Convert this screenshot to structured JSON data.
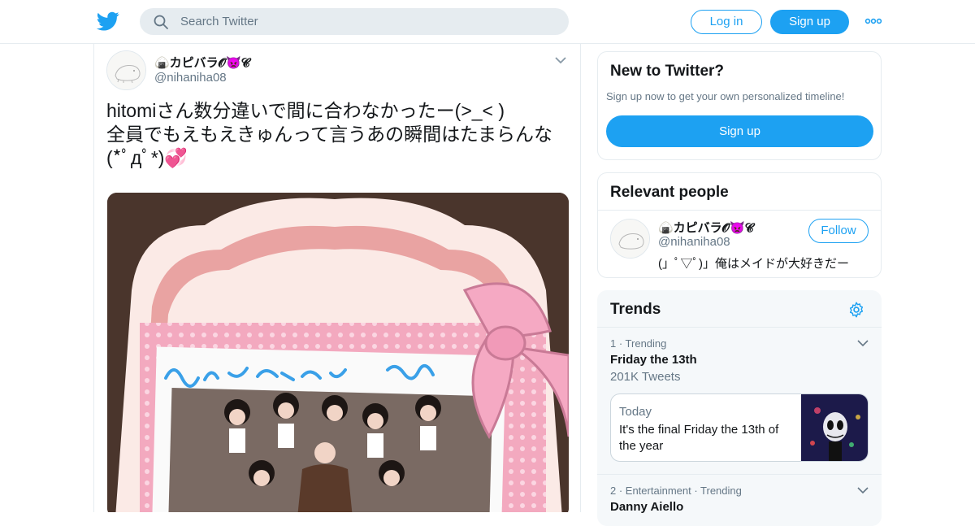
{
  "colors": {
    "brand": "#1da1f2",
    "muted": "#657786",
    "border": "#e6ecf0",
    "trends_bg": "#f5f8fa"
  },
  "topbar": {
    "logo": "twitter-bird-icon",
    "search_placeholder": "Search Twitter",
    "login_label": "Log in",
    "signup_label": "Sign up",
    "more_icon": "more-dots-icon"
  },
  "tweet": {
    "display_name": "🍙カピバラ𝓞👿𝓒",
    "handle": "@nihaniha08",
    "text": "hitomiさん数分違いで間に合わなかったー(>_< )\n全員でもえもえきゅんって言うあの瞬間はたまらんな(*ﾟдﾟ*)💞",
    "photo_icon": "tweet-photo"
  },
  "new_to_twitter": {
    "title": "New to Twitter?",
    "subtitle": "Sign up now to get your own personalized timeline!",
    "button_label": "Sign up"
  },
  "relevant_people": {
    "title": "Relevant people",
    "person": {
      "display_name": "🍙カピバラ𝓞👿𝓒",
      "handle": "@nihaniha08",
      "bio": "(」ﾟ▽ﾟ)」俺はメイドが大好きだー",
      "follow_label": "Follow"
    }
  },
  "trends": {
    "title": "Trends",
    "settings_icon": "settings-gear-icon",
    "items": [
      {
        "meta": "1 · Trending",
        "name": "Friday the 13th",
        "count": "201K Tweets",
        "moment": {
          "when": "Today",
          "title": "It's the final Friday the 13th of the year"
        }
      },
      {
        "meta": "2 · Entertainment · Trending",
        "name": "Danny Aiello"
      }
    ]
  }
}
